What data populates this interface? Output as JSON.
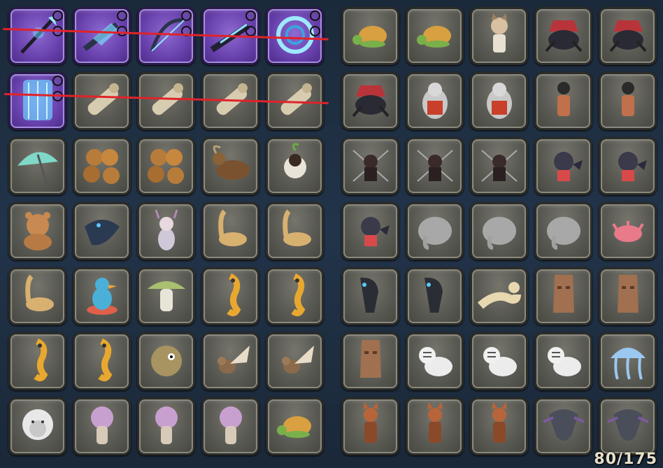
{
  "counter": "80/175",
  "left_grid": [
    {
      "icon": "glaive-icon",
      "rare": true,
      "marked": true
    },
    {
      "icon": "shield-weapon-icon",
      "rare": true,
      "marked": true
    },
    {
      "icon": "bow-weapon-icon",
      "rare": true,
      "marked": true
    },
    {
      "icon": "gunblade-icon",
      "rare": true,
      "marked": true
    },
    {
      "icon": "chakram-icon",
      "rare": true,
      "marked": true
    },
    {
      "icon": "armor-set-icon",
      "rare": true,
      "marked": true
    },
    {
      "icon": "scroll-icon",
      "rare": false,
      "marked": false
    },
    {
      "icon": "scroll-icon",
      "rare": false,
      "marked": false
    },
    {
      "icon": "scroll-icon",
      "rare": false,
      "marked": false
    },
    {
      "icon": "scroll-icon",
      "rare": false,
      "marked": false
    },
    {
      "icon": "umbrella-icon",
      "rare": false,
      "marked": false
    },
    {
      "icon": "rock-golem-icon",
      "rare": false,
      "marked": false
    },
    {
      "icon": "rock-golem-icon",
      "rare": false,
      "marked": false
    },
    {
      "icon": "goat-icon",
      "rare": false,
      "marked": false
    },
    {
      "icon": "sprout-creature-icon",
      "rare": false,
      "marked": false
    },
    {
      "icon": "bear-icon",
      "rare": false,
      "marked": false
    },
    {
      "icon": "dark-dragon-icon",
      "rare": false,
      "marked": false
    },
    {
      "icon": "horned-girl-icon",
      "rare": false,
      "marked": false
    },
    {
      "icon": "dinosaur-icon",
      "rare": false,
      "marked": false
    },
    {
      "icon": "dinosaur-icon",
      "rare": false,
      "marked": false
    },
    {
      "icon": "dinosaur-icon",
      "rare": false,
      "marked": false
    },
    {
      "icon": "duck-float-icon",
      "rare": false,
      "marked": false
    },
    {
      "icon": "mushroom-cat-icon",
      "rare": false,
      "marked": false
    },
    {
      "icon": "seahorse-icon",
      "rare": false,
      "marked": false
    },
    {
      "icon": "seahorse-icon",
      "rare": false,
      "marked": false
    },
    {
      "icon": "seahorse-icon",
      "rare": false,
      "marked": false
    },
    {
      "icon": "seahorse-icon",
      "rare": false,
      "marked": false
    },
    {
      "icon": "pufferfish-icon",
      "rare": false,
      "marked": false
    },
    {
      "icon": "bird-icon",
      "rare": false,
      "marked": false
    },
    {
      "icon": "bird-icon",
      "rare": false,
      "marked": false
    },
    {
      "icon": "white-beast-icon",
      "rare": false,
      "marked": false
    },
    {
      "icon": "mushroom-doll-icon",
      "rare": false,
      "marked": false
    },
    {
      "icon": "mushroom-doll-icon",
      "rare": false,
      "marked": false
    },
    {
      "icon": "mushroom-doll-icon",
      "rare": false,
      "marked": false
    },
    {
      "icon": "turtle-icon",
      "rare": false,
      "marked": false
    }
  ],
  "right_grid": [
    {
      "icon": "turtle-icon"
    },
    {
      "icon": "turtle-icon"
    },
    {
      "icon": "catgirl-icon"
    },
    {
      "icon": "spider-machine-icon"
    },
    {
      "icon": "spider-machine-icon"
    },
    {
      "icon": "spider-machine-icon"
    },
    {
      "icon": "penguin-icon"
    },
    {
      "icon": "penguin-icon"
    },
    {
      "icon": "warrior-girl-icon"
    },
    {
      "icon": "warrior-girl-icon"
    },
    {
      "icon": "dark-knight-icon"
    },
    {
      "icon": "dark-knight-icon"
    },
    {
      "icon": "dark-knight-icon"
    },
    {
      "icon": "bat-doll-icon"
    },
    {
      "icon": "bat-doll-icon"
    },
    {
      "icon": "bat-doll-icon"
    },
    {
      "icon": "elephant-icon"
    },
    {
      "icon": "elephant-icon"
    },
    {
      "icon": "elephant-icon"
    },
    {
      "icon": "axolotl-icon"
    },
    {
      "icon": "dark-horse-icon"
    },
    {
      "icon": "dark-horse-icon"
    },
    {
      "icon": "ferret-icon"
    },
    {
      "icon": "moai-icon"
    },
    {
      "icon": "moai-icon"
    },
    {
      "icon": "moai-icon"
    },
    {
      "icon": "white-tiger-icon"
    },
    {
      "icon": "white-tiger-icon"
    },
    {
      "icon": "white-tiger-icon"
    },
    {
      "icon": "jellyfish-icon"
    },
    {
      "icon": "fox-girl-icon"
    },
    {
      "icon": "fox-girl-icon"
    },
    {
      "icon": "fox-girl-icon"
    },
    {
      "icon": "dragon-icon"
    },
    {
      "icon": "dragon-icon"
    }
  ]
}
